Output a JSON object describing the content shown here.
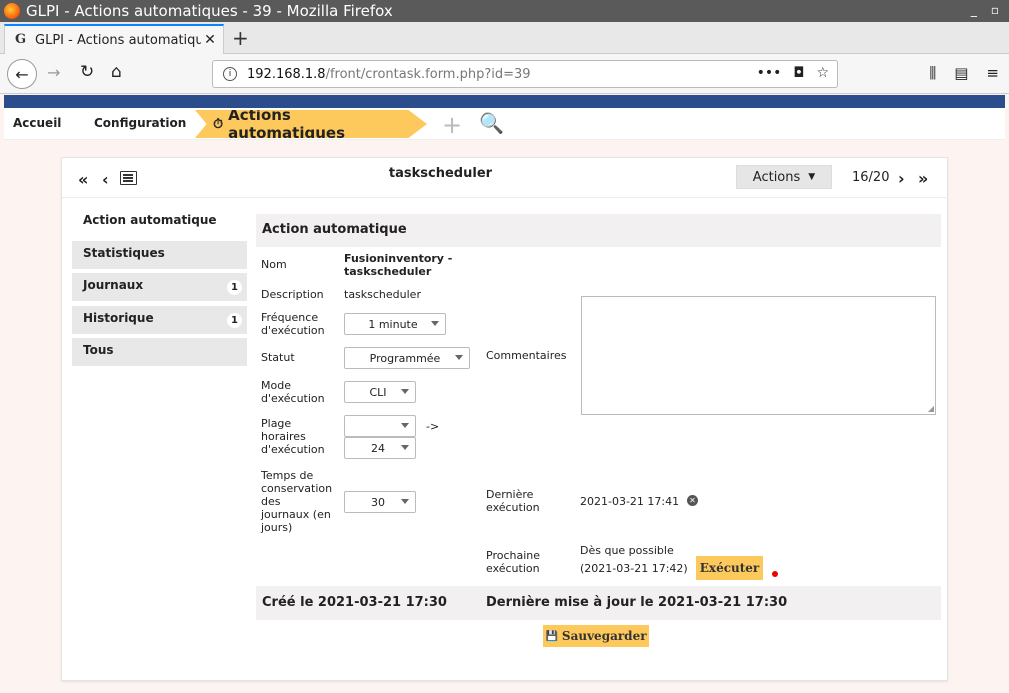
{
  "window": {
    "title": "GLPI - Actions automatiques - 39 - Mozilla Firefox",
    "min_glyph": "_",
    "restore_glyph": "▫"
  },
  "tab": {
    "label": "GLPI - Actions automatiques",
    "close_glyph": "✕",
    "icon_glyph": "G"
  },
  "newtab_glyph": "+",
  "url": {
    "host": "192.168.1.8",
    "path": "/front/crontask.form.php?id=39",
    "info_glyph": "i",
    "more_glyph": "•••",
    "pocket_glyph": "◘",
    "star_glyph": "☆"
  },
  "nav_glyphs": {
    "back": "←",
    "forward": "→",
    "reload": "↻",
    "home": "⌂",
    "library": "⫼",
    "sidebar": "▤",
    "menu": "≡"
  },
  "breadcrumb": {
    "home": "Accueil",
    "config": "Configuration",
    "current": "Actions automatiques",
    "timer_glyph": "⏱",
    "add_glyph": "+",
    "search_glyph": "🔍"
  },
  "record_nav": {
    "first_glyph": "«",
    "prev_glyph": "‹",
    "next_glyph": "›",
    "last_glyph": "»",
    "title": "taskscheduler",
    "actions_label": "Actions",
    "actions_caret": "▼",
    "position": "16/20"
  },
  "sidebar": {
    "items": [
      {
        "label": "Action automatique",
        "badge": ""
      },
      {
        "label": "Statistiques",
        "badge": ""
      },
      {
        "label": "Journaux",
        "badge": "1"
      },
      {
        "label": "Historique",
        "badge": "1"
      },
      {
        "label": "Tous",
        "badge": ""
      }
    ]
  },
  "form": {
    "header": "Action automatique",
    "name_label": "Nom",
    "name_value_line1": "Fusioninventory -",
    "name_value_line2": "taskscheduler",
    "description_label": "Description",
    "description_value": "taskscheduler",
    "frequency_label_line1": "Fréquence",
    "frequency_label_line2": "d'exécution",
    "frequency_value": "1 minute",
    "status_label": "Statut",
    "status_value": "Programmée",
    "comments_label": "Commentaires",
    "comments_value": "",
    "mode_label_line1": "Mode",
    "mode_label_line2": "d'exécution",
    "mode_value": "CLI",
    "range_label_line1": "Plage",
    "range_label_line2": "horaires",
    "range_label_line3": "d'exécution",
    "range_start_value": "",
    "range_arrow": "->",
    "range_end_value": "24",
    "retention_label_line1": "Temps de",
    "retention_label_line2": "conservation",
    "retention_label_line3": "des",
    "retention_label_line4": "journaux (en",
    "retention_label_line5": "jours)",
    "retention_value": "30",
    "last_run_label_line1": "Dernière",
    "last_run_label_line2": "exécution",
    "last_run_value": "2021-03-21 17:41",
    "clear_glyph": "✕",
    "next_run_label_line1": "Prochaine",
    "next_run_label_line2": "exécution",
    "next_run_value_line1": "Dès que possible",
    "next_run_value_line2": "(2021-03-21 17:42)",
    "run_button": "Exécuter",
    "created": "Créé le 2021-03-21 17:30",
    "updated": "Dernière mise à jour le 2021-03-21 17:30",
    "save_button": "Sauvegarder",
    "save_glyph": "💾",
    "resize_glyph": "◢"
  }
}
